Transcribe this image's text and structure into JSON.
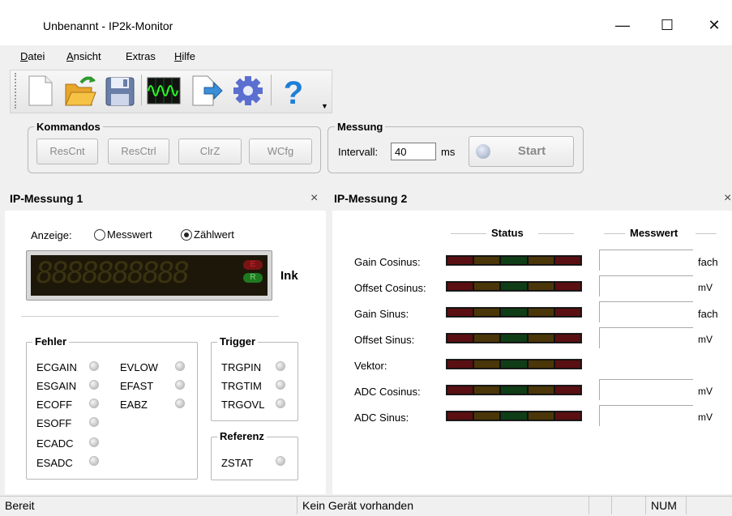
{
  "window": {
    "title": "Unbenannt - IP2k-Monitor"
  },
  "menu": {
    "datei": {
      "pre": "",
      "ul": "D",
      "post": "atei"
    },
    "ansicht": {
      "pre": "",
      "ul": "A",
      "post": "nsicht"
    },
    "extras": {
      "pre": "Extras",
      "ul": "",
      "post": ""
    },
    "hilfe": {
      "pre": "",
      "ul": "H",
      "post": "ilfe"
    }
  },
  "toolbar": {
    "icons": [
      "new-document-icon",
      "open-folder-icon",
      "save-disk-icon",
      "oscilloscope-icon",
      "export-document-icon",
      "settings-gear-icon",
      "help-question-icon"
    ]
  },
  "kommandos": {
    "label": "Kommandos",
    "buttons": [
      "ResCnt",
      "ResCtrl",
      "ClrZ",
      "WCfg"
    ]
  },
  "messung": {
    "label": "Messung",
    "interval_label": "Intervall:",
    "interval_value": "40",
    "unit": "ms",
    "start_label": "Start"
  },
  "panel1": {
    "title": "IP-Messung 1",
    "close": "×",
    "anzeige_label": "Anzeige:",
    "radio_messwert": "Messwert",
    "radio_zaehlwert": "Zählwert",
    "display_digits": "8888888888",
    "ind_e": "E",
    "ind_r": "R",
    "unit": "Ink",
    "fehler": {
      "label": "Fehler",
      "col1": [
        "ECGAIN",
        "ESGAIN",
        "ECOFF",
        "ESOFF",
        "ECADC",
        "ESADC"
      ],
      "col2": [
        "EVLOW",
        "EFAST",
        "EABZ"
      ]
    },
    "trigger": {
      "label": "Trigger",
      "items": [
        "TRGPIN",
        "TRGTIM",
        "TRGOVL"
      ]
    },
    "referenz": {
      "label": "Referenz",
      "items": [
        "ZSTAT"
      ]
    }
  },
  "panel2": {
    "title": "IP-Messung 2",
    "close": "×",
    "status_header": "Status",
    "messwert_header": "Messwert",
    "rows": [
      {
        "label": "Gain Cosinus:",
        "unit": "fach"
      },
      {
        "label": "Offset Cosinus:",
        "unit": "mV"
      },
      {
        "label": "Gain Sinus:",
        "unit": "fach"
      },
      {
        "label": "Offset Sinus:",
        "unit": "mV"
      },
      {
        "label": "Vektor:",
        "unit": ""
      },
      {
        "label": "ADC Cosinus:",
        "unit": "mV"
      },
      {
        "label": "ADC Sinus:",
        "unit": "mV"
      }
    ]
  },
  "statusbar": {
    "left": "Bereit",
    "middle": "Kein Gerät vorhanden",
    "num": "NUM"
  },
  "colors": {
    "bar_red": "#5a0f12",
    "bar_amber": "#4a3608",
    "bar_green": "#0f3d16",
    "lcd_bg": "#1c1708",
    "lcd_digit": "#3a3210"
  }
}
